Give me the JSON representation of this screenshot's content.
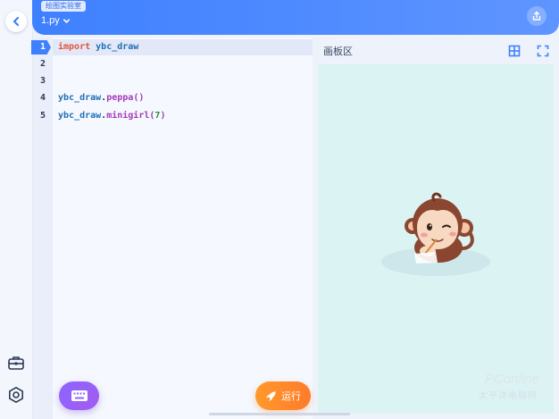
{
  "header": {
    "badge": "绘图实验室",
    "file_name": "1.py"
  },
  "editor": {
    "line_numbers": [
      "1",
      "2",
      "3",
      "4",
      "5"
    ],
    "lines": [
      {
        "keyword": "import",
        "module": "ybc_draw"
      },
      {},
      {},
      {
        "object": "ybc_draw",
        "dot": ".",
        "method": "peppa",
        "open": "(",
        "arg": "",
        "close": ")"
      },
      {
        "object": "ybc_draw",
        "dot": ".",
        "method": "minigirl",
        "open": "(",
        "arg": "7",
        "close": ")"
      }
    ]
  },
  "panel": {
    "title": "画板区"
  },
  "buttons": {
    "run_label": "运行"
  },
  "watermark": {
    "line1": "PConline",
    "line2": "太平洋电脑网"
  },
  "icons": {
    "back": "chevron-left-icon",
    "share": "share-icon",
    "toolbox": "toolbox-icon",
    "settings": "settings-icon",
    "grid": "grid-icon",
    "fullscreen": "fullscreen-icon",
    "keyboard": "keyboard-icon",
    "run": "rocket-icon"
  },
  "colors": {
    "accent": "#3e80ff",
    "run": "#ff8a2b",
    "keyboard": "#9a60f4",
    "canvas": "#dcf3f3"
  }
}
